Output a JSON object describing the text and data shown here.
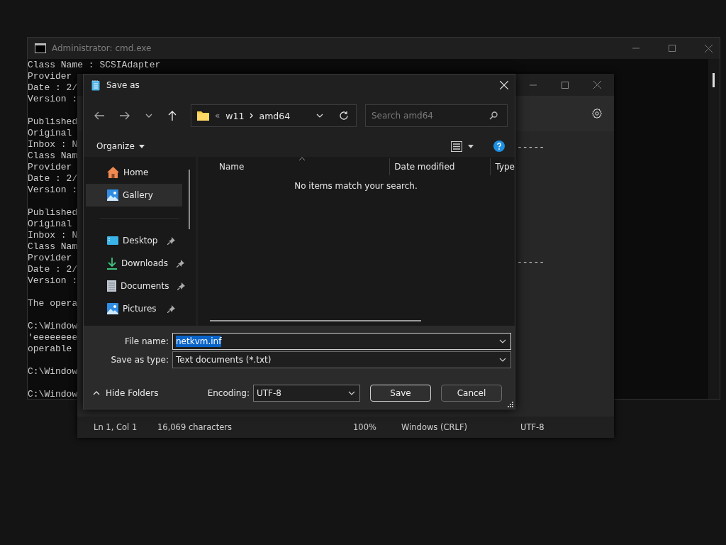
{
  "cmd_window": {
    "title": "Administrator: cmd.exe",
    "blocks": [
      [
        "Class Name : SCSIAdapter",
        "Provider",
        "Date : 2/",
        "Version :"
      ],
      [
        "Published",
        "Original",
        "Inbox : N",
        "Class Nam",
        "Provider",
        "Date : 2/",
        "Version :"
      ],
      [
        "Published",
        "Original",
        "Inbox : N",
        "Class Nam",
        "Provider",
        "Date : 2/",
        "Version :"
      ],
      [
        "The opera"
      ],
      [
        "C:\\Window",
        "'eeeeeeee",
        "operable"
      ],
      [
        "C:\\Window"
      ],
      [
        "C:\\Window"
      ]
    ]
  },
  "notepad_window": {
    "text_lines": [
      "-----",
      "-----"
    ],
    "status_bar": [
      "Ln 1, Col 1",
      "16,069 characters",
      "100%",
      "Windows (CRLF)",
      "UTF-8"
    ]
  },
  "save_dialog": {
    "title": "Save as",
    "address": {
      "overflow": "«",
      "segments": [
        "w11",
        "amd64"
      ]
    },
    "search": {
      "placeholder": "Search amd64"
    },
    "organize": "Organize",
    "nav_groups": [
      [
        {
          "label": "Home",
          "kind": "home",
          "pinned": false,
          "selected": false
        },
        {
          "label": "Gallery",
          "kind": "gallery",
          "pinned": false,
          "selected": true
        }
      ],
      [
        {
          "label": "Desktop",
          "kind": "desktop",
          "pinned": true,
          "selected": false
        },
        {
          "label": "Downloads",
          "kind": "downloads",
          "pinned": true,
          "selected": false
        },
        {
          "label": "Documents",
          "kind": "documents",
          "pinned": true,
          "selected": false
        },
        {
          "label": "Pictures",
          "kind": "pictures",
          "pinned": true,
          "selected": false
        }
      ]
    ],
    "columns": [
      "Name",
      "Date modified",
      "Type"
    ],
    "empty_message": "No items match your search.",
    "file_name": {
      "label": "File name:",
      "value": "netkvm.inf",
      "selected": true
    },
    "save_as_type": {
      "label": "Save as type:",
      "value": "Text documents (*.txt)"
    },
    "hide_folders": "Hide Folders",
    "encoding": {
      "label": "Encoding:",
      "value": "UTF-8"
    },
    "buttons": [
      {
        "label": "Save",
        "kind": "default"
      },
      {
        "label": "Cancel",
        "kind": "normal"
      }
    ]
  }
}
